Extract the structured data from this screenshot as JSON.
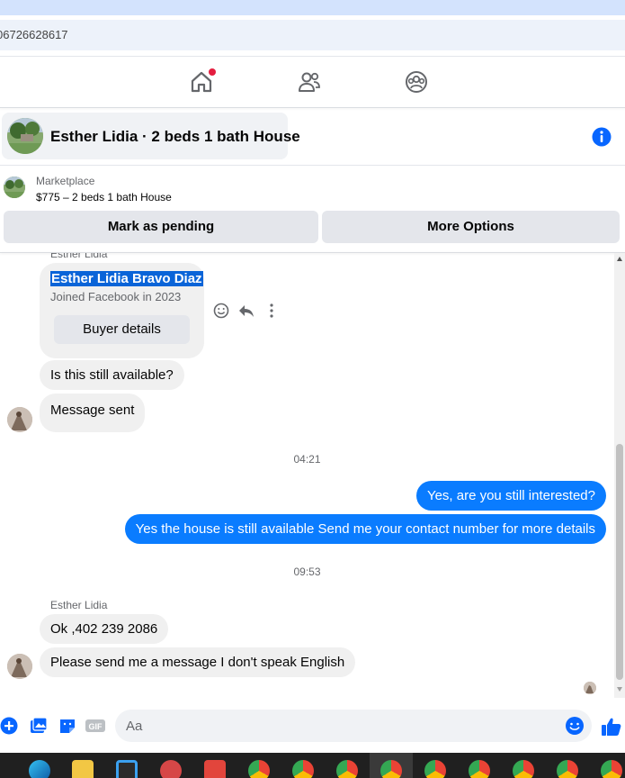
{
  "browser": {
    "url_text": "06726628617"
  },
  "nav": {
    "home_icon": "home-icon",
    "friends_icon": "friends-icon",
    "groups_icon": "groups-icon"
  },
  "conversation": {
    "title": "Esther Lidia · 2 beds 1 bath House",
    "info_icon": "info-icon"
  },
  "marketplace": {
    "label": "Marketplace",
    "listing": "$775 – 2 beds 1 bath House",
    "mark_pending_label": "Mark as pending",
    "more_options_label": "More Options"
  },
  "profile_card": {
    "sender_top": "Esther Lidia",
    "full_name": "Esther Lidia Bravo Diaz",
    "joined": "Joined Facebook in 2023",
    "buyer_details_label": "Buyer details"
  },
  "messages": {
    "m1": "Is this still available?",
    "m2": "Message sent",
    "time1": "04:21",
    "m3": "Yes, are you still interested?",
    "m4": "Yes the house is still available Send me your contact number for more details",
    "time2": "09:53",
    "sender2": "Esther Lidia",
    "m5": "Ok ,402 239  2086",
    "m6": "Please send me a message I don't speak English"
  },
  "composer": {
    "placeholder": "Aa"
  },
  "colors": {
    "accent": "#0a7cff",
    "incoming_bubble": "#f0f0f0",
    "notification": "#e41e3f",
    "info": "#0866ff"
  }
}
